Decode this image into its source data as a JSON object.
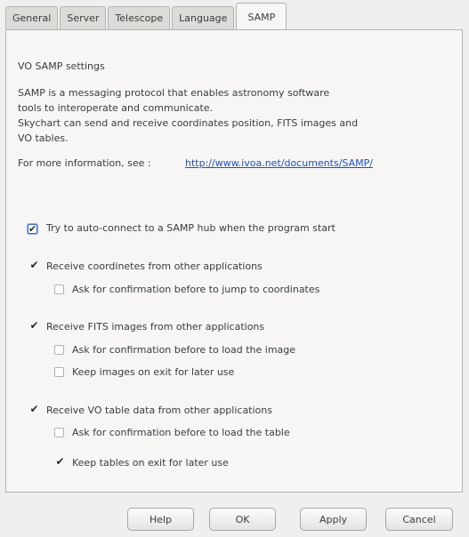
{
  "tabs": [
    "General",
    "Server",
    "Telescope",
    "Language",
    "SAMP"
  ],
  "active_tab": "SAMP",
  "section_title": "VO SAMP settings",
  "description": [
    "SAMP is a messaging protocol that enables astronomy software",
    "tools to interoperate and communicate.",
    "Skychart can send and receive coordinates position, FITS images and",
    "VO tables."
  ],
  "more_info_label": "For more information, see :",
  "more_info_link": "http://www.ivoa.net/documents/SAMP/",
  "options": {
    "auto_connect": {
      "label": "Try to auto-connect to a SAMP hub when the program start",
      "checked": true
    },
    "recv_coords": {
      "label": "Receive coordinetes from other applications",
      "checked": true
    },
    "confirm_coords": {
      "label": "Ask for confirmation before to jump to coordinates",
      "checked": false
    },
    "recv_fits": {
      "label": "Receive FITS images from other applications",
      "checked": true
    },
    "confirm_fits": {
      "label": "Ask for confirmation before to load the image",
      "checked": false
    },
    "keep_images": {
      "label": "Keep images on exit for later use",
      "checked": false
    },
    "recv_vo": {
      "label": "Receive VO table data from other applications",
      "checked": true
    },
    "confirm_table": {
      "label": "Ask for confirmation before to load the table",
      "checked": false
    },
    "keep_tables": {
      "label": "Keep tables on exit for later use",
      "checked": true
    }
  },
  "buttons": {
    "help": "Help",
    "ok": "OK",
    "apply": "Apply",
    "cancel": "Cancel"
  },
  "colors": {
    "link": "#1a52c7",
    "background": "#f0efee",
    "panel": "#f7f6f5",
    "focus": "#3d6fbd"
  }
}
